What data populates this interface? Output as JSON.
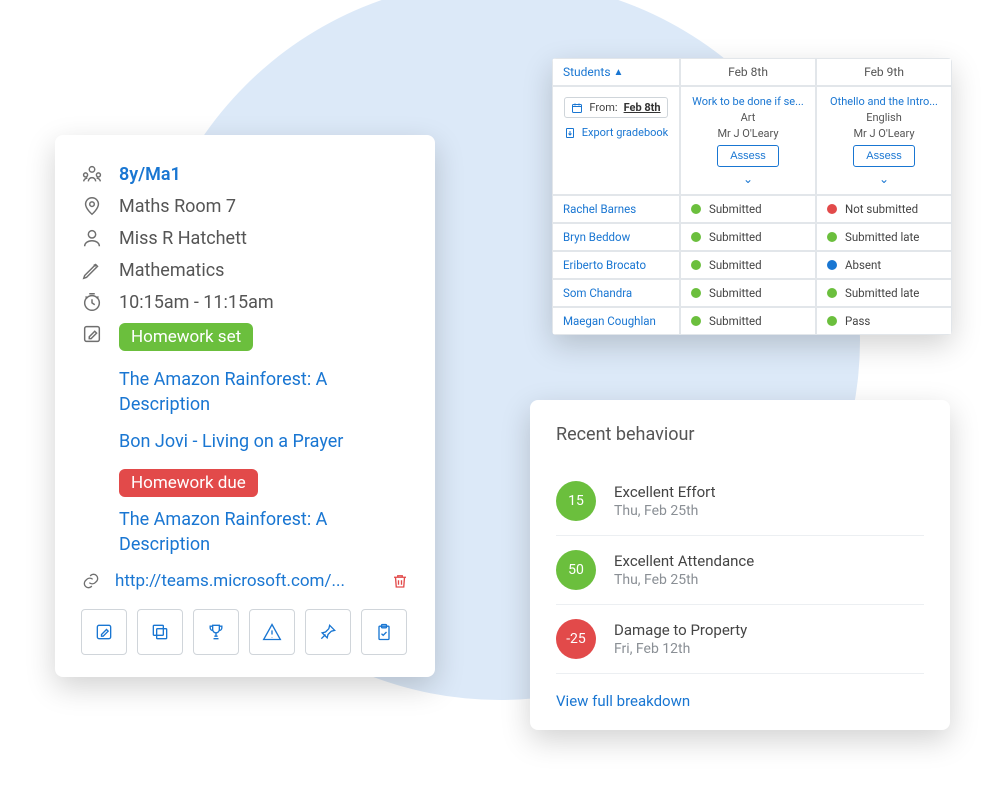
{
  "lesson": {
    "class": "8y/Ma1",
    "room": "Maths Room 7",
    "teacher": "Miss R Hatchett",
    "subject": "Mathematics",
    "time": "10:15am - 11:15am",
    "hw_set_badge": "Homework set",
    "hw_set_items": [
      "The Amazon Rainforest: A Description",
      "Bon Jovi - Living on a Prayer"
    ],
    "hw_due_badge": "Homework due",
    "hw_due_items": [
      "The Amazon Rainforest: A Description"
    ],
    "url": "http://teams.microsoft.com/...",
    "actions": [
      "edit",
      "copy",
      "trophy",
      "warning",
      "pin",
      "clipboard"
    ]
  },
  "gradebook": {
    "students_header": "Students",
    "dates": [
      "Feb 8th",
      "Feb 9th"
    ],
    "from_label": "From:",
    "from_date": "Feb 8th",
    "export_label": "Export gradebook",
    "assess_label": "Assess",
    "assignments": [
      {
        "title": "Work to be done if se...",
        "subject": "Art",
        "teacher": "Mr J O'Leary"
      },
      {
        "title": "Othello and the Intro...",
        "subject": "English",
        "teacher": "Mr J O'Leary"
      }
    ],
    "rows": [
      {
        "name": "Rachel Barnes",
        "statuses": [
          {
            "dot": "green",
            "label": "Submitted"
          },
          {
            "dot": "red",
            "label": "Not submitted"
          }
        ]
      },
      {
        "name": "Bryn Beddow",
        "statuses": [
          {
            "dot": "green",
            "label": "Submitted"
          },
          {
            "dot": "green",
            "label": "Submitted late"
          }
        ]
      },
      {
        "name": "Eriberto Brocato",
        "statuses": [
          {
            "dot": "green",
            "label": "Submitted"
          },
          {
            "dot": "blue",
            "label": "Absent"
          }
        ]
      },
      {
        "name": "Som Chandra",
        "statuses": [
          {
            "dot": "green",
            "label": "Submitted"
          },
          {
            "dot": "green",
            "label": "Submitted late"
          }
        ]
      },
      {
        "name": "Maegan Coughlan",
        "statuses": [
          {
            "dot": "green",
            "label": "Submitted"
          },
          {
            "dot": "green",
            "label": "Pass"
          }
        ]
      }
    ]
  },
  "behaviour": {
    "title": "Recent behaviour",
    "items": [
      {
        "score": "15",
        "sign": "pos",
        "label": "Excellent Effort",
        "date": "Thu, Feb 25th"
      },
      {
        "score": "50",
        "sign": "pos",
        "label": "Excellent Attendance",
        "date": "Thu, Feb 25th"
      },
      {
        "score": "-25",
        "sign": "neg",
        "label": "Damage to Property",
        "date": "Fri, Feb 12th"
      }
    ],
    "view_all": "View full breakdown"
  }
}
